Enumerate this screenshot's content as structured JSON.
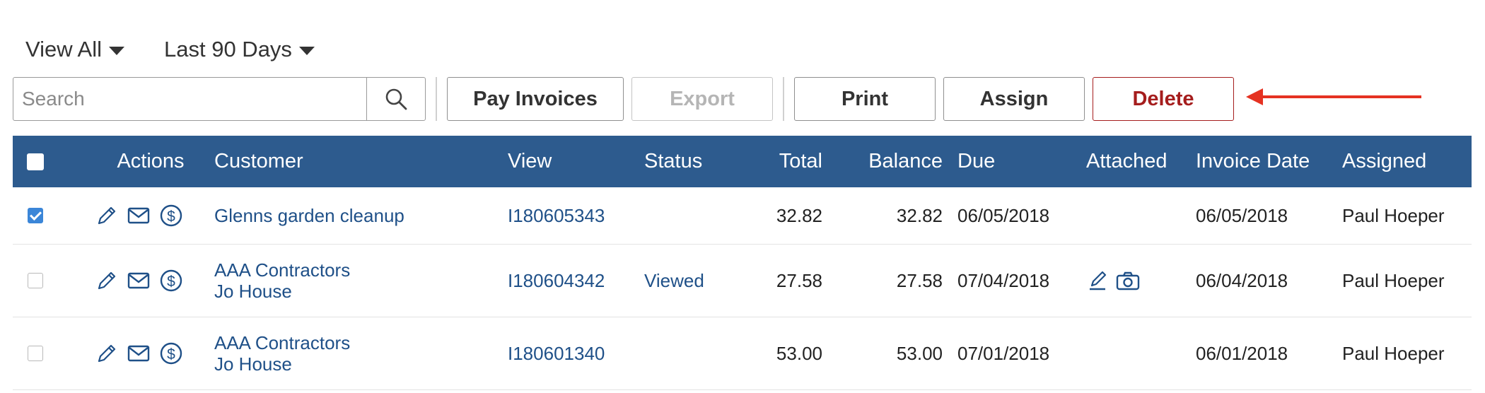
{
  "filters": {
    "view": "View All",
    "range": "Last 90 Days"
  },
  "search": {
    "placeholder": "Search",
    "value": ""
  },
  "toolbar": {
    "pay_invoices": "Pay Invoices",
    "export": "Export",
    "print": "Print",
    "assign": "Assign",
    "delete": "Delete"
  },
  "colors": {
    "header_bg": "#2d5b8e",
    "link": "#1f5088",
    "delete": "#a51d1d",
    "annotation_arrow": "#e53222",
    "checkbox": "#3b86d8"
  },
  "columns": {
    "actions": "Actions",
    "customer": "Customer",
    "view": "View",
    "status": "Status",
    "total": "Total",
    "balance": "Balance",
    "due": "Due",
    "attached": "Attached",
    "invoice_date": "Invoice Date",
    "assigned": "Assigned"
  },
  "rows": [
    {
      "checked": true,
      "customer": "Glenns garden cleanup",
      "customer_sub": "",
      "view": "I180605343",
      "status": "",
      "total": "32.82",
      "balance": "32.82",
      "due": "06/05/2018",
      "attached": [],
      "invoice_date": "06/05/2018",
      "assigned": "Paul Hoeper"
    },
    {
      "checked": false,
      "customer": "AAA Contractors",
      "customer_sub": "Jo House",
      "view": "I180604342",
      "status": "Viewed",
      "total": "27.58",
      "balance": "27.58",
      "due": "07/04/2018",
      "attached": [
        "signature-icon",
        "camera-icon"
      ],
      "invoice_date": "06/04/2018",
      "assigned": "Paul Hoeper"
    },
    {
      "checked": false,
      "customer": "AAA Contractors",
      "customer_sub": "Jo House",
      "view": "I180601340",
      "status": "",
      "total": "53.00",
      "balance": "53.00",
      "due": "07/01/2018",
      "attached": [],
      "invoice_date": "06/01/2018",
      "assigned": "Paul Hoeper"
    }
  ]
}
